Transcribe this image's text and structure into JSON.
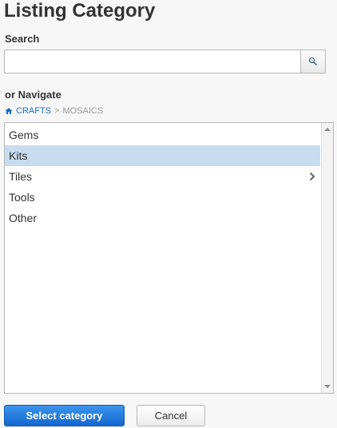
{
  "title": "Listing Category",
  "search": {
    "label": "Search",
    "value": "",
    "placeholder": ""
  },
  "navigate": {
    "label": "or Navigate",
    "breadcrumb": {
      "home_link": "CRAFTS",
      "separator": ">",
      "current": "MOSAICS"
    }
  },
  "categories": [
    {
      "label": "Gems",
      "selected": false,
      "has_children": false
    },
    {
      "label": "Kits",
      "selected": true,
      "has_children": false
    },
    {
      "label": "Tiles",
      "selected": false,
      "has_children": true
    },
    {
      "label": "Tools",
      "selected": false,
      "has_children": false
    },
    {
      "label": "Other",
      "selected": false,
      "has_children": false
    }
  ],
  "buttons": {
    "select": "Select category",
    "cancel": "Cancel"
  },
  "colors": {
    "accent": "#1a6fc4",
    "selected_row": "#c8dcf0",
    "primary_button": "#1467cf"
  }
}
